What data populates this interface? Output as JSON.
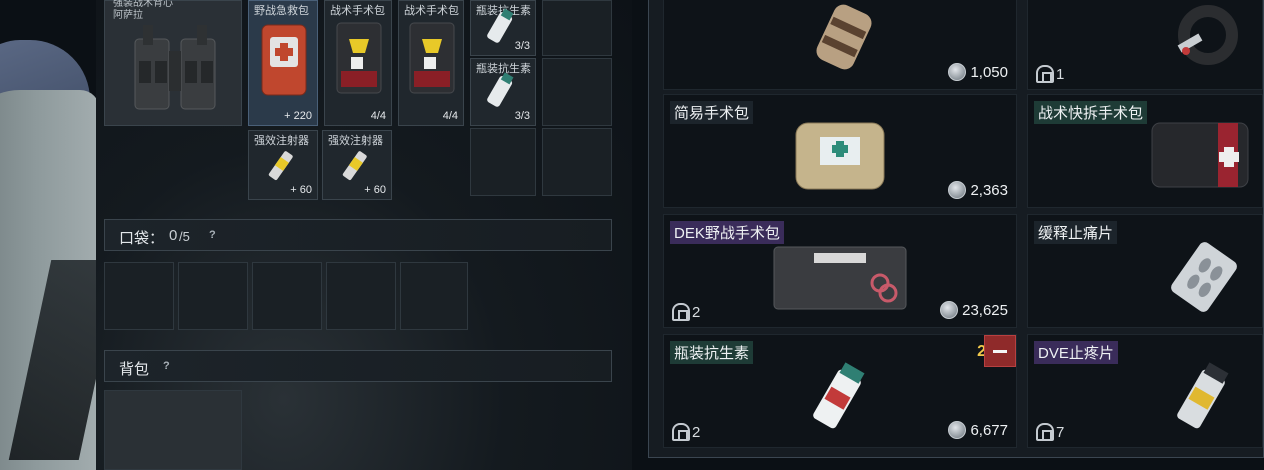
{
  "vest": {
    "name_line1": "强装战术背心",
    "name_line2": "阿萨拉"
  },
  "rig_slots": [
    {
      "name": "野战急救包",
      "qty": "+ 220"
    },
    {
      "name": "战术手术包",
      "qty": "4/4"
    },
    {
      "name": "战术手术包",
      "qty": "4/4"
    },
    {
      "name": "瓶装抗生素",
      "qty": "3/3"
    },
    {
      "name": "瓶装抗生素",
      "qty": "3/3"
    },
    {
      "name": "强效注射器",
      "qty": "+ 60"
    },
    {
      "name": "强效注射器",
      "qty": "+ 60"
    }
  ],
  "pockets": {
    "label": "口袋：",
    "count": "0",
    "capacity": "/5",
    "help": "?"
  },
  "backpack": {
    "label": "背包",
    "help": "?"
  },
  "shop_items": [
    {
      "title": "",
      "price": "1,050",
      "stock": ""
    },
    {
      "title": "",
      "price": "",
      "stock": "1"
    },
    {
      "title": "简易手术包",
      "price": "2,363",
      "stock": ""
    },
    {
      "title": "战术快拆手术包",
      "price": "",
      "stock": ""
    },
    {
      "title": "DEK野战手术包",
      "price": "23,625",
      "stock": "2"
    },
    {
      "title": "缓释止痛片",
      "price": "",
      "stock": ""
    },
    {
      "title": "瓶装抗生素",
      "price": "6,677",
      "stock": "2",
      "selected_qty": "2"
    },
    {
      "title": "DVE止疼片",
      "price": "",
      "stock": "7"
    }
  ],
  "colors": {
    "rare_purple": "#3a2c5a",
    "uncommon_green": "#1e3b36",
    "remove_red": "#8f2a2a",
    "qty_yellow": "#f2c94c"
  }
}
